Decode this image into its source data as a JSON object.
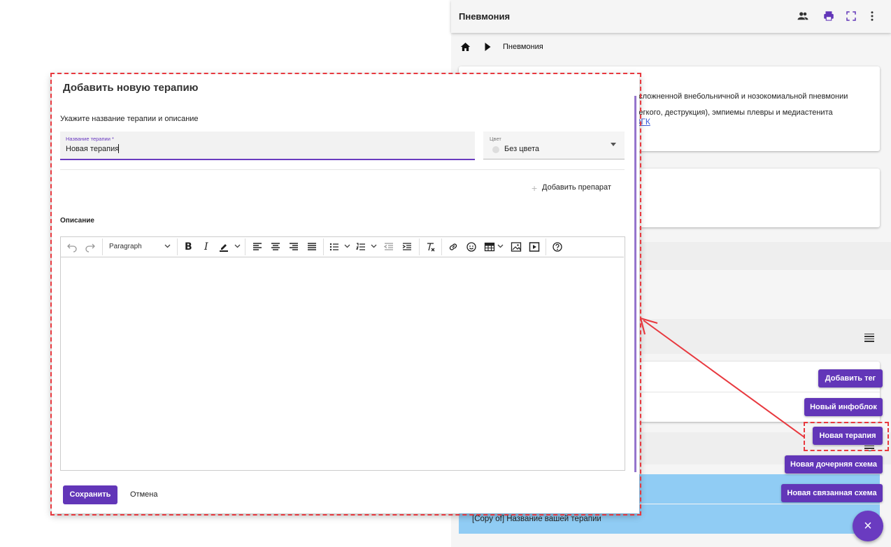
{
  "app": {
    "title": "Пневмония",
    "breadcrumb": {
      "current": "Пневмония"
    },
    "card1": {
      "line1": "осложненной внебольничной и нозокомиальной пневмонии",
      "line2": "легкого, деструкция), эмпиемы плевры и медиастенита",
      "link": "ОГК"
    },
    "blue_row_text": "[Copy of] Название вашей терапии",
    "actions": {
      "add_tag": "Добавить тег",
      "new_infoblock": "Новый инфоблок",
      "new_therapy": "Новая терапия",
      "new_child_scheme": "Новая дочерняя схема",
      "new_linked_scheme": "Новая связанная схема"
    },
    "close_fab": "×"
  },
  "dialog": {
    "title": "Добавить новую терапию",
    "subtitle": "Укажите название терапии и описание",
    "name_field": {
      "label": "Название терапии *",
      "value": "Новая терапия"
    },
    "color_field": {
      "label": "Цвет",
      "value": "Без цвета"
    },
    "add_drug": "Добавить препарат",
    "description_label": "Описание",
    "editor": {
      "paragraph_select": "Paragraph"
    },
    "save": "Сохранить",
    "cancel": "Отмена"
  },
  "colors": {
    "accent": "#6236b8",
    "annotation": "#e8393f",
    "blue_row": "#90ccf4"
  }
}
